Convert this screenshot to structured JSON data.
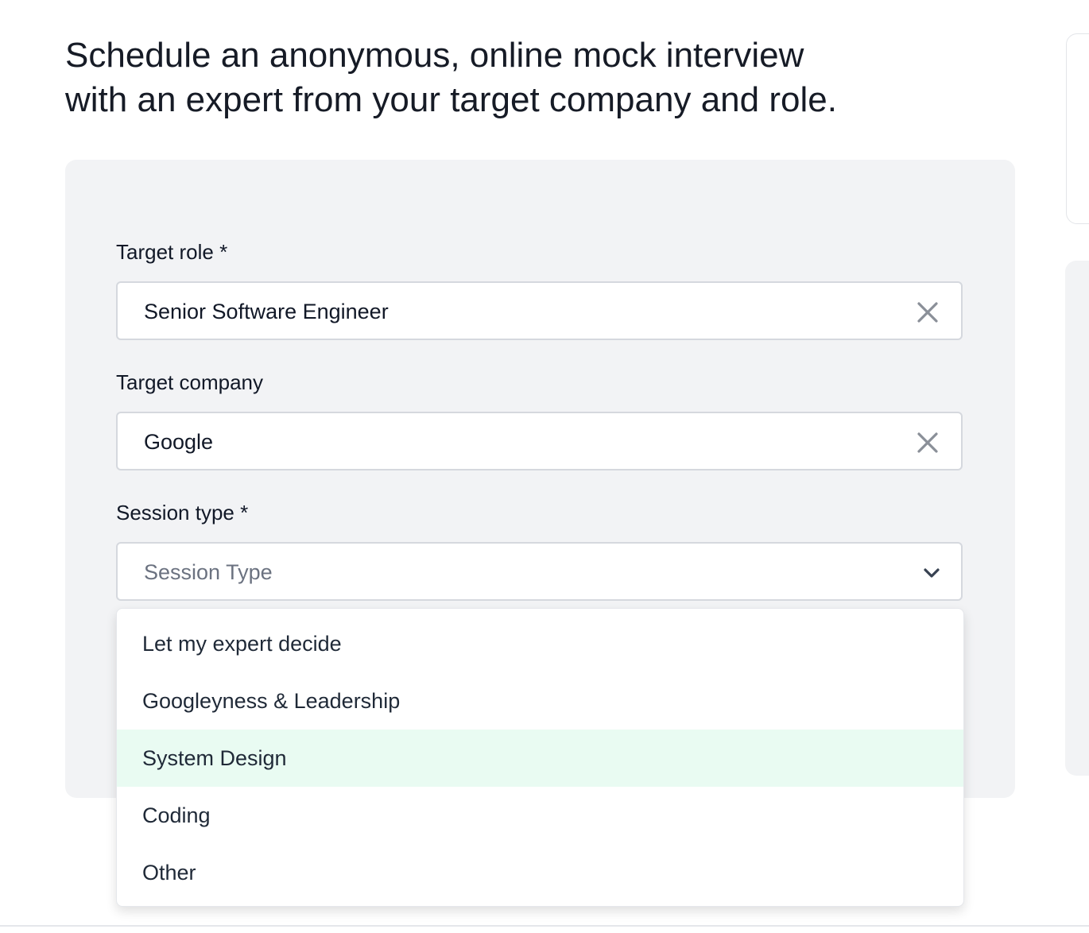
{
  "headline": {
    "line1": "Schedule an anonymous, online mock interview",
    "line2": "with an expert from your target company and role."
  },
  "form": {
    "target_role": {
      "label": "Target role *",
      "value": "Senior Software Engineer"
    },
    "target_company": {
      "label": "Target company",
      "value": "Google"
    },
    "session_type": {
      "label": "Session type *",
      "placeholder": "Session Type",
      "options": [
        "Let my expert decide",
        "Googleyness & Leadership",
        "System Design",
        "Coding",
        "Other"
      ],
      "highlighted_option": "System Design"
    }
  },
  "icons": {
    "clear": "close-x-icon",
    "dropdown": "chevron-down-icon"
  },
  "colors": {
    "highlight": "#e9fbf2",
    "panel": "#f2f3f5",
    "text": "#111827",
    "icon": "#8a8f98"
  }
}
